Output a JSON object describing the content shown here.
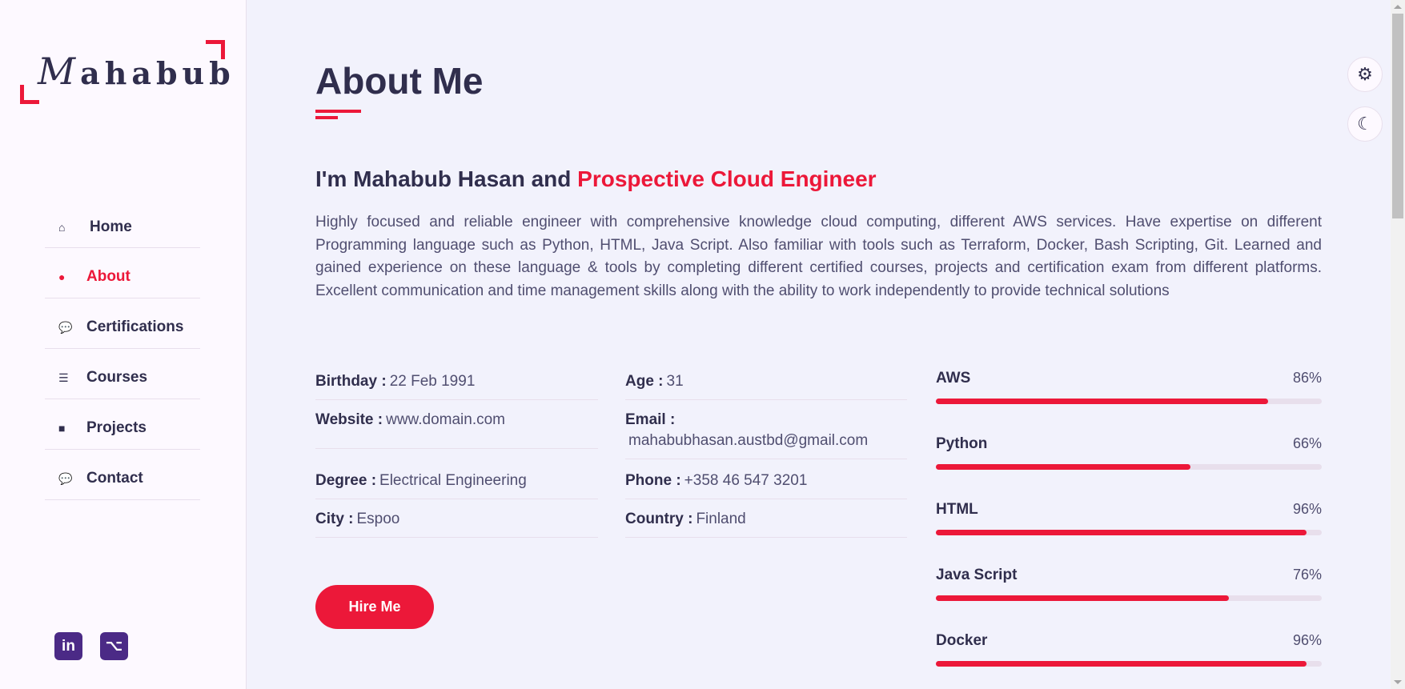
{
  "logo": {
    "first_letter": "M",
    "rest": "ahabub"
  },
  "nav": {
    "items": [
      {
        "label": "Home",
        "icon": "home-icon",
        "glyph": "⌂"
      },
      {
        "label": "About",
        "icon": "user-icon",
        "glyph": "●"
      },
      {
        "label": "Certifications",
        "icon": "comments-icon",
        "glyph": "💬"
      },
      {
        "label": "Courses",
        "icon": "list-icon",
        "glyph": "☰"
      },
      {
        "label": "Projects",
        "icon": "briefcase-icon",
        "glyph": "■"
      },
      {
        "label": "Contact",
        "icon": "comments-icon",
        "glyph": "💬"
      }
    ],
    "active": "About"
  },
  "social": {
    "linkedin": "in",
    "github": "⌥"
  },
  "main": {
    "title": "About Me",
    "intro_prefix": "I'm Mahabub Hasan and ",
    "intro_highlight": "Prospective Cloud Engineer",
    "bio": "Highly focused and reliable engineer with comprehensive knowledge cloud computing, different AWS services. Have expertise on different Programming language such as Python, HTML, Java Script. Also familiar with tools such as Terraform, Docker, Bash Scripting, Git. Learned and gained experience on these language & tools by completing different certified courses, projects and certification exam from different platforms. Excellent communication and time management skills along with the ability to work independently to provide technical solutions",
    "info_left": [
      {
        "label": "Birthday :",
        "value": "22 Feb 1991"
      },
      {
        "label": "Website :",
        "value": "www.domain.com"
      },
      {
        "label": "Degree :",
        "value": "Electrical Engineering"
      },
      {
        "label": "City :",
        "value": "Espoo"
      }
    ],
    "info_right": [
      {
        "label": "Age :",
        "value": "31"
      },
      {
        "label": "Email :",
        "value": "mahabubhasan.austbd@gmail.com"
      },
      {
        "label": "Phone :",
        "value": "+358 46 547 3201"
      },
      {
        "label": "Country :",
        "value": "Finland"
      }
    ],
    "hire_label": "Hire Me"
  },
  "skills": [
    {
      "name": "AWS",
      "percent_label": "86%",
      "level": 0.86
    },
    {
      "name": "Python",
      "percent_label": "66%",
      "level": 0.66
    },
    {
      "name": "HTML",
      "percent_label": "96%",
      "level": 0.96
    },
    {
      "name": "Java Script",
      "percent_label": "76%",
      "level": 0.76
    },
    {
      "name": "Docker",
      "percent_label": "96%",
      "level": 0.96
    }
  ],
  "controls": {
    "settings_icon": "⚙",
    "theme_icon": "☾"
  },
  "colors": {
    "accent": "#ec1839",
    "text": "#302e4d",
    "sidebar_bg": "#fdf9ff",
    "main_bg": "#f2f2fc"
  }
}
